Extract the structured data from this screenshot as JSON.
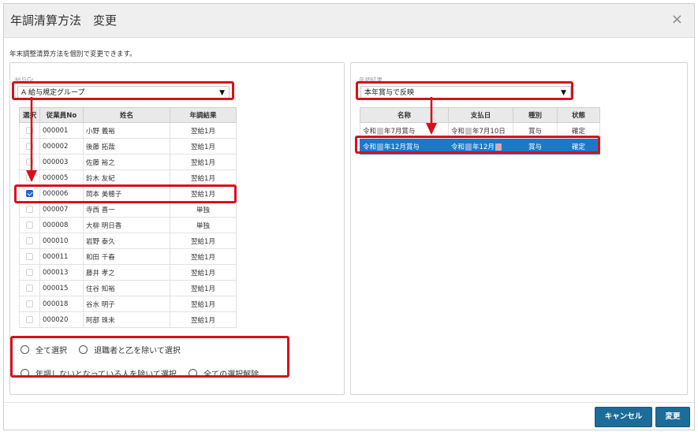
{
  "dialog": {
    "title": "年調清算方法　変更",
    "close_icon": "×",
    "description": "年末調整清算方法を個別で変更できます。"
  },
  "left": {
    "group_label": "給与Gr",
    "group_value": "A 給与規定グループ",
    "columns": [
      "選択",
      "従業員No",
      "姓名",
      "年調結果"
    ],
    "rows": [
      {
        "checked": false,
        "no": "000001",
        "name": "小野 義裕",
        "result": "翌給1月"
      },
      {
        "checked": false,
        "no": "000002",
        "name": "後藤 拓哉",
        "result": "翌給1月"
      },
      {
        "checked": false,
        "no": "000003",
        "name": "佐藤 裕之",
        "result": "翌給1月"
      },
      {
        "checked": false,
        "no": "000005",
        "name": "鈴木 友紀",
        "result": "翌給1月"
      },
      {
        "checked": true,
        "no": "000006",
        "name": "岡本 美穂子",
        "result": "翌給1月"
      },
      {
        "checked": false,
        "no": "000007",
        "name": "寺西 喜一",
        "result": "単独"
      },
      {
        "checked": false,
        "no": "000008",
        "name": "大柳 明日香",
        "result": "単独"
      },
      {
        "checked": false,
        "no": "000010",
        "name": "岩野 泰久",
        "result": "翌給1月"
      },
      {
        "checked": false,
        "no": "000011",
        "name": "和田 千春",
        "result": "翌給1月"
      },
      {
        "checked": false,
        "no": "000013",
        "name": "藤井 孝之",
        "result": "翌給1月"
      },
      {
        "checked": false,
        "no": "000015",
        "name": "住谷 知裕",
        "result": "翌給1月"
      },
      {
        "checked": false,
        "no": "000018",
        "name": "谷水 明子",
        "result": "翌給1月"
      },
      {
        "checked": false,
        "no": "000020",
        "name": "阿部 珠未",
        "result": "翌給1月"
      }
    ],
    "options": {
      "select_all": "全て選択",
      "exclude_retired": "退職者と乙を除いて選択",
      "exclude_no_adjust": "年調しないとなっている人を除いて選択",
      "clear_all": "全ての選択解除"
    }
  },
  "right": {
    "result_label": "年調結果",
    "result_value": "本年賞与で反映",
    "columns": [
      "名称",
      "支払日",
      "種別",
      "状態"
    ],
    "rows": [
      {
        "name_pre": "令和",
        "name_post": "年7月賞与",
        "date_pre": "令和",
        "date_post": "年7月10日",
        "type": "賞与",
        "status": "確定",
        "selected": false
      },
      {
        "name_pre": "令和",
        "name_post": "年12月賞与",
        "date_pre": "令和",
        "date_post": "年12月",
        "type": "賞与",
        "status": "確定",
        "selected": true
      }
    ]
  },
  "buttons": {
    "cancel": "キャンセル",
    "change": "変更"
  },
  "colors": {
    "highlight": "#d8101c",
    "primary_button": "#1b6c98",
    "selected_row": "#1e78c8"
  }
}
